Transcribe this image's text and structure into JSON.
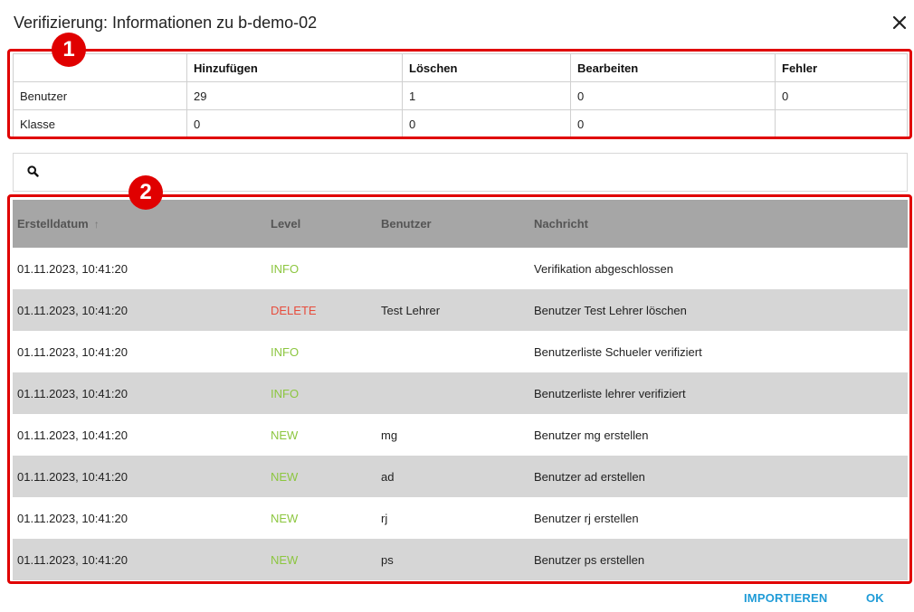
{
  "dialog": {
    "title": "Verifizierung: Informationen zu b-demo-02"
  },
  "callouts": [
    "1",
    "2"
  ],
  "summary": {
    "headers": [
      "",
      "Hinzufügen",
      "Löschen",
      "Bearbeiten",
      "Fehler"
    ],
    "rows": [
      {
        "label": "Benutzer",
        "values": [
          "29",
          "1",
          "0",
          "0"
        ]
      },
      {
        "label": "Klasse",
        "values": [
          "0",
          "0",
          "0",
          ""
        ]
      }
    ]
  },
  "search": {
    "value": "",
    "placeholder": ""
  },
  "log": {
    "headers": {
      "date": "Erstelldatum",
      "level": "Level",
      "user": "Benutzer",
      "message": "Nachricht"
    },
    "rows": [
      {
        "date": "01.11.2023, 10:41:20",
        "level": "INFO",
        "user": "",
        "message": "Verifikation abgeschlossen"
      },
      {
        "date": "01.11.2023, 10:41:20",
        "level": "DELETE",
        "user": "Test Lehrer",
        "message": "Benutzer Test Lehrer löschen"
      },
      {
        "date": "01.11.2023, 10:41:20",
        "level": "INFO",
        "user": "",
        "message": "Benutzerliste Schueler verifiziert"
      },
      {
        "date": "01.11.2023, 10:41:20",
        "level": "INFO",
        "user": "",
        "message": "Benutzerliste lehrer verifiziert"
      },
      {
        "date": "01.11.2023, 10:41:20",
        "level": "NEW",
        "user": "mg",
        "message": "Benutzer mg erstellen"
      },
      {
        "date": "01.11.2023, 10:41:20",
        "level": "NEW",
        "user": "ad",
        "message": "Benutzer ad erstellen"
      },
      {
        "date": "01.11.2023, 10:41:20",
        "level": "NEW",
        "user": "rj",
        "message": "Benutzer rj erstellen"
      },
      {
        "date": "01.11.2023, 10:41:20",
        "level": "NEW",
        "user": "ps",
        "message": "Benutzer ps erstellen"
      }
    ]
  },
  "level_colors": {
    "INFO": "#8cc63f",
    "NEW": "#8cc63f",
    "DELETE": "#e74c3c"
  },
  "footer": {
    "import_label": "IMPORTIEREN",
    "ok_label": "OK"
  },
  "colors": {
    "accent": "#1e9bd7",
    "callout": "#e00000",
    "header_bg": "#a6a6a6",
    "alt_row_bg": "#d6d6d6"
  }
}
